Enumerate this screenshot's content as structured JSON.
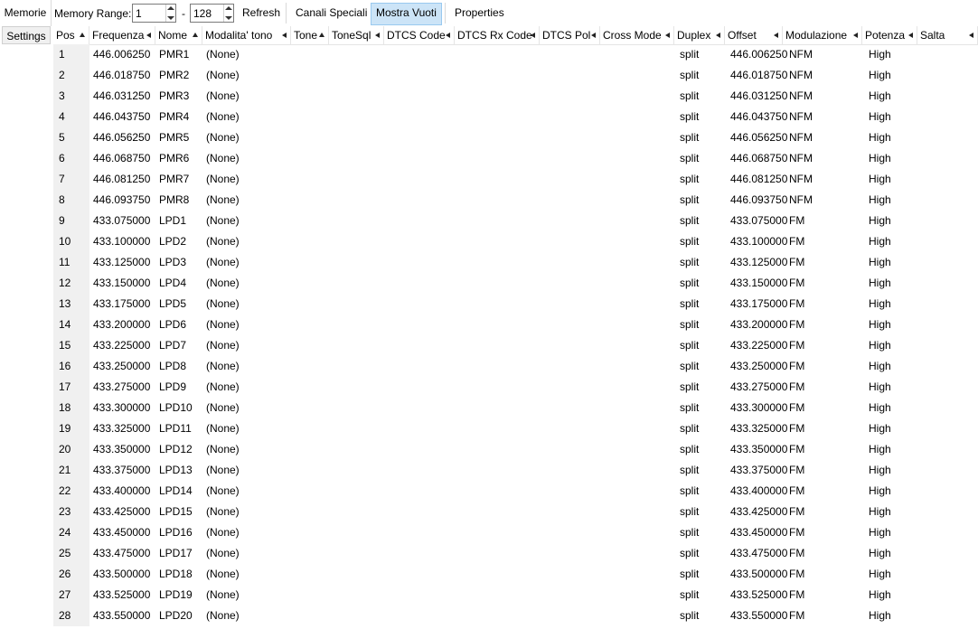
{
  "toolbar": {
    "memorie_tab": "Memorie",
    "memory_range_label": "Memory Range:",
    "range_start": "1",
    "range_sep": "-",
    "range_end": "128",
    "refresh": "Refresh",
    "canali_speciali": "Canali Speciali",
    "mostra_vuoti": "Mostra Vuoti",
    "properties": "Properties"
  },
  "settings_tab": "Settings",
  "columns": [
    "Pos",
    "Frequenza",
    "Nome",
    "Modalita' tono",
    "Tone",
    "ToneSql",
    "DTCS Code",
    "DTCS Rx Code",
    "DTCS Pol",
    "Cross Mode",
    "Duplex",
    "Offset",
    "Modulazione",
    "Potenza",
    "Salta"
  ],
  "rows": [
    [
      "1",
      "446.006250",
      "PMR1",
      "(None)",
      "split",
      "446.006250",
      "NFM",
      "High"
    ],
    [
      "2",
      "446.018750",
      "PMR2",
      "(None)",
      "split",
      "446.018750",
      "NFM",
      "High"
    ],
    [
      "3",
      "446.031250",
      "PMR3",
      "(None)",
      "split",
      "446.031250",
      "NFM",
      "High"
    ],
    [
      "4",
      "446.043750",
      "PMR4",
      "(None)",
      "split",
      "446.043750",
      "NFM",
      "High"
    ],
    [
      "5",
      "446.056250",
      "PMR5",
      "(None)",
      "split",
      "446.056250",
      "NFM",
      "High"
    ],
    [
      "6",
      "446.068750",
      "PMR6",
      "(None)",
      "split",
      "446.068750",
      "NFM",
      "High"
    ],
    [
      "7",
      "446.081250",
      "PMR7",
      "(None)",
      "split",
      "446.081250",
      "NFM",
      "High"
    ],
    [
      "8",
      "446.093750",
      "PMR8",
      "(None)",
      "split",
      "446.093750",
      "NFM",
      "High"
    ],
    [
      "9",
      "433.075000",
      "LPD1",
      "(None)",
      "split",
      "433.075000",
      "FM",
      "High"
    ],
    [
      "10",
      "433.100000",
      "LPD2",
      "(None)",
      "split",
      "433.100000",
      "FM",
      "High"
    ],
    [
      "11",
      "433.125000",
      "LPD3",
      "(None)",
      "split",
      "433.125000",
      "FM",
      "High"
    ],
    [
      "12",
      "433.150000",
      "LPD4",
      "(None)",
      "split",
      "433.150000",
      "FM",
      "High"
    ],
    [
      "13",
      "433.175000",
      "LPD5",
      "(None)",
      "split",
      "433.175000",
      "FM",
      "High"
    ],
    [
      "14",
      "433.200000",
      "LPD6",
      "(None)",
      "split",
      "433.200000",
      "FM",
      "High"
    ],
    [
      "15",
      "433.225000",
      "LPD7",
      "(None)",
      "split",
      "433.225000",
      "FM",
      "High"
    ],
    [
      "16",
      "433.250000",
      "LPD8",
      "(None)",
      "split",
      "433.250000",
      "FM",
      "High"
    ],
    [
      "17",
      "433.275000",
      "LPD9",
      "(None)",
      "split",
      "433.275000",
      "FM",
      "High"
    ],
    [
      "18",
      "433.300000",
      "LPD10",
      "(None)",
      "split",
      "433.300000",
      "FM",
      "High"
    ],
    [
      "19",
      "433.325000",
      "LPD11",
      "(None)",
      "split",
      "433.325000",
      "FM",
      "High"
    ],
    [
      "20",
      "433.350000",
      "LPD12",
      "(None)",
      "split",
      "433.350000",
      "FM",
      "High"
    ],
    [
      "21",
      "433.375000",
      "LPD13",
      "(None)",
      "split",
      "433.375000",
      "FM",
      "High"
    ],
    [
      "22",
      "433.400000",
      "LPD14",
      "(None)",
      "split",
      "433.400000",
      "FM",
      "High"
    ],
    [
      "23",
      "433.425000",
      "LPD15",
      "(None)",
      "split",
      "433.425000",
      "FM",
      "High"
    ],
    [
      "24",
      "433.450000",
      "LPD16",
      "(None)",
      "split",
      "433.450000",
      "FM",
      "High"
    ],
    [
      "25",
      "433.475000",
      "LPD17",
      "(None)",
      "split",
      "433.475000",
      "FM",
      "High"
    ],
    [
      "26",
      "433.500000",
      "LPD18",
      "(None)",
      "split",
      "433.500000",
      "FM",
      "High"
    ],
    [
      "27",
      "433.525000",
      "LPD19",
      "(None)",
      "split",
      "433.525000",
      "FM",
      "High"
    ],
    [
      "28",
      "433.550000",
      "LPD20",
      "(None)",
      "split",
      "433.550000",
      "FM",
      "High"
    ]
  ]
}
